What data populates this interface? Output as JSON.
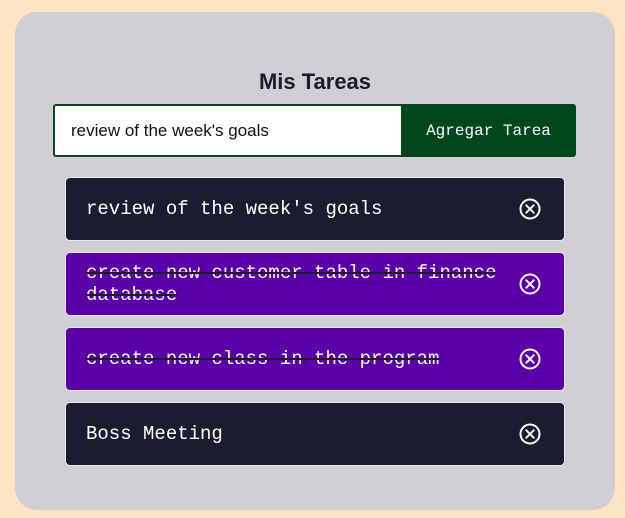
{
  "app": {
    "title": "Mis Tareas"
  },
  "form": {
    "input_value": "review of the week's goals",
    "add_label": "Agregar Tarea"
  },
  "colors": {
    "page_bg": "#ffe4c4",
    "card_bg": "#d0cfd4",
    "button_bg": "#00471b",
    "task_pending_bg": "#1c1c30",
    "task_completed_bg": "#5b00a8"
  },
  "tasks": [
    {
      "text": "review of the week's goals",
      "completed": false,
      "delete_icon": "circle-x-icon"
    },
    {
      "text": "create new customer table in finance database",
      "completed": true,
      "delete_icon": "circle-x-icon"
    },
    {
      "text": "create new class in the program",
      "completed": true,
      "delete_icon": "circle-x-icon"
    },
    {
      "text": "Boss Meeting",
      "completed": false,
      "delete_icon": "circle-x-icon"
    }
  ]
}
